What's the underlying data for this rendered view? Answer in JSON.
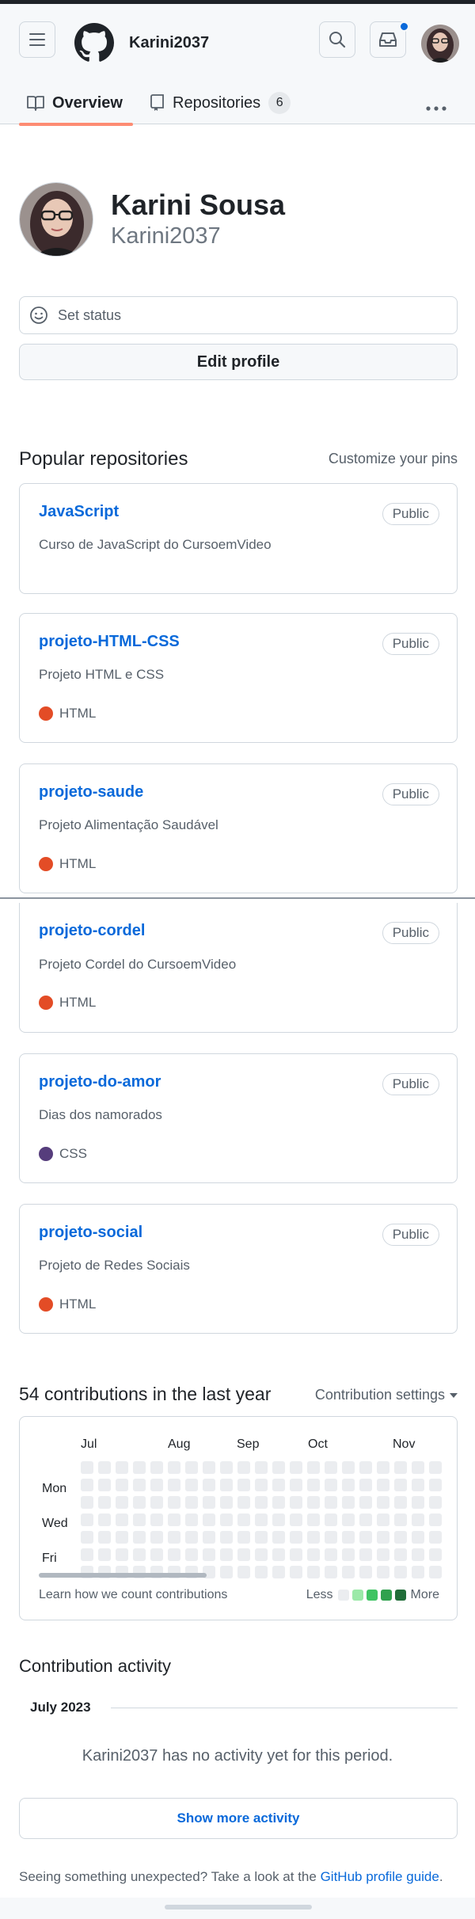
{
  "header": {
    "username": "Karini2037",
    "menu_icon": "hamburger-icon",
    "logo_icon": "github-logo-icon",
    "search_icon": "search-icon",
    "inbox_icon": "inbox-icon",
    "notification_color": "#0969da"
  },
  "tabs": [
    {
      "label": "Overview",
      "icon": "book-icon",
      "selected": true
    },
    {
      "label": "Repositories",
      "icon": "repo-icon",
      "count": "6"
    }
  ],
  "profile": {
    "full_name": "Karini Sousa",
    "login": "Karini2037",
    "status_placeholder": "Set status",
    "edit_label": "Edit profile"
  },
  "popular": {
    "title": "Popular repositories",
    "customize_label": "Customize your pins",
    "repos": [
      {
        "name": "JavaScript",
        "visibility": "Public",
        "description": "Curso de JavaScript do CursoemVideo",
        "language": "",
        "language_color": ""
      },
      {
        "name": "projeto-HTML-CSS",
        "visibility": "Public",
        "description": "Projeto HTML e CSS",
        "language": "HTML",
        "language_color": "#e34c26"
      },
      {
        "name": "projeto-saude",
        "visibility": "Public",
        "description": "Projeto Alimentação Saudável",
        "language": "HTML",
        "language_color": "#e34c26"
      },
      {
        "name": "projeto-cordel",
        "visibility": "Public",
        "description": "Projeto Cordel do CursoemVideo",
        "language": "HTML",
        "language_color": "#e34c26"
      },
      {
        "name": "projeto-do-amor",
        "visibility": "Public",
        "description": "Dias dos namorados",
        "language": "CSS",
        "language_color": "#563d7c"
      },
      {
        "name": "projeto-social",
        "visibility": "Public",
        "description": "Projeto de Redes Sociais",
        "language": "HTML",
        "language_color": "#e34c26"
      }
    ]
  },
  "contributions": {
    "title": "54 contributions in the last year",
    "settings_label": "Contribution settings",
    "months": [
      "Jul",
      "Aug",
      "Sep",
      "Oct",
      "Nov"
    ],
    "days": [
      "Mon",
      "Wed",
      "Fri"
    ],
    "learn_label": "Learn how we count contributions",
    "legend_less": "Less",
    "legend_more": "More",
    "legend_colors": [
      "#ebedf0",
      "#9be9a8",
      "#40c463",
      "#30a14e",
      "#216e39"
    ]
  },
  "activity": {
    "title": "Contribution activity",
    "period": "July 2023",
    "empty_message": "Karini2037 has no activity yet for this period.",
    "show_more_label": "Show more activity"
  },
  "footer": {
    "note_text": "Seeing something unexpected? Take a look at the ",
    "guide_link": "GitHub profile guide",
    "note_end": "."
  }
}
